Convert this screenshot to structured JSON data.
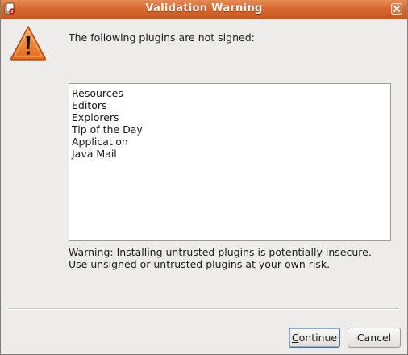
{
  "window": {
    "title": "Validation Warning",
    "titlebar_color": "#d76a32"
  },
  "dialog": {
    "header": "The following plugins are not signed:",
    "plugins": [
      "Resources",
      "Editors",
      "Explorers",
      "Tip of the Day",
      "Application",
      "Java Mail"
    ],
    "warning_line1": "Warning: Installing untrusted plugins is potentially insecure.",
    "warning_line2": "Use unsigned or untrusted plugins at your own risk.",
    "icon": "warning-triangle-icon",
    "icon_color": "#e8731f"
  },
  "buttons": {
    "continue_mnemonic": "C",
    "continue_rest": "ontinue",
    "cancel_label": "Cancel"
  }
}
